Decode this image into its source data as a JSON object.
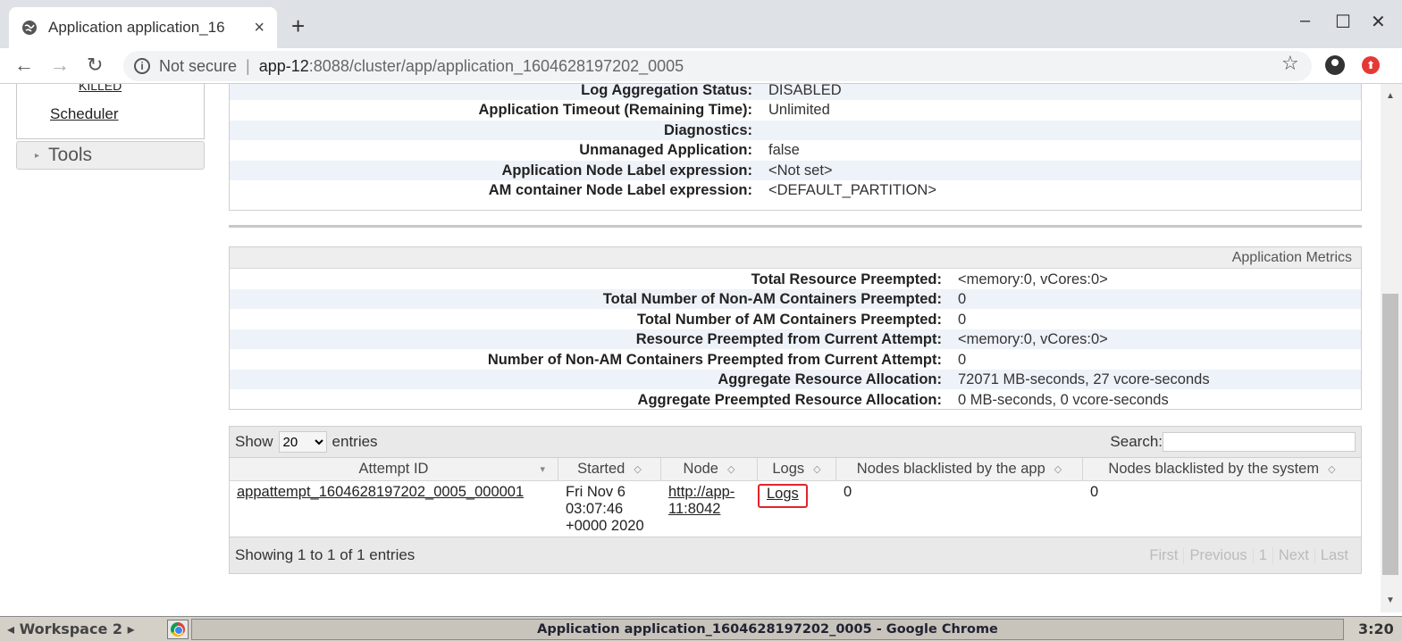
{
  "browser": {
    "tab_title": "Application application_16",
    "tab_close": "×",
    "new_tab": "+",
    "win_min": "–",
    "win_max": "☐",
    "win_close": "✕",
    "url_not_secure": "Not secure",
    "url_host": "app-12",
    "url_path": ":8088/cluster/app/application_1604628197202_0005"
  },
  "sidebar": {
    "killed_label": "KILLED",
    "scheduler_label": "Scheduler",
    "tools_label": "Tools"
  },
  "app_overview": {
    "rows": [
      {
        "key": "Log Aggregation Status:",
        "value": "DISABLED"
      },
      {
        "key": "Application Timeout (Remaining Time):",
        "value": "Unlimited"
      },
      {
        "key": "Diagnostics:",
        "value": ""
      },
      {
        "key": "Unmanaged Application:",
        "value": "false"
      },
      {
        "key": "Application Node Label expression:",
        "value": "<Not set>"
      },
      {
        "key": "AM container Node Label expression:",
        "value": "<DEFAULT_PARTITION>"
      }
    ]
  },
  "metrics": {
    "header": "Application Metrics",
    "rows": [
      {
        "key": "Total Resource Preempted:",
        "value": "<memory:0, vCores:0>"
      },
      {
        "key": "Total Number of Non-AM Containers Preempted:",
        "value": "0"
      },
      {
        "key": "Total Number of AM Containers Preempted:",
        "value": "0"
      },
      {
        "key": "Resource Preempted from Current Attempt:",
        "value": "<memory:0, vCores:0>"
      },
      {
        "key": "Number of Non-AM Containers Preempted from Current Attempt:",
        "value": "0"
      },
      {
        "key": "Aggregate Resource Allocation:",
        "value": "72071 MB-seconds, 27 vcore-seconds"
      },
      {
        "key": "Aggregate Preempted Resource Allocation:",
        "value": "0 MB-seconds, 0 vcore-seconds"
      }
    ]
  },
  "attempts_table": {
    "show_label": "Show",
    "page_size": "20",
    "entries_label": "entries",
    "search_label": "Search:",
    "columns": [
      "Attempt ID",
      "Started",
      "Node",
      "Logs",
      "Nodes blacklisted by the app",
      "Nodes blacklisted by the system"
    ],
    "rows": [
      {
        "attempt_id": "appattempt_1604628197202_0005_000001",
        "started_l1": "Fri Nov 6",
        "started_l2": "03:07:46",
        "started_l3": "+0000 2020",
        "node_l1": "http://app-",
        "node_l2": "11:8042",
        "logs": "Logs",
        "blacklisted_app": "0",
        "blacklisted_system": "0"
      }
    ],
    "footer_info": "Showing 1 to 1 of 1 entries",
    "pager": {
      "first": "First",
      "previous": "Previous",
      "page": "1",
      "next": "Next",
      "last": "Last"
    }
  },
  "taskbar": {
    "workspace": "◂ Workspace 2 ▸",
    "window_title": "Application application_1604628197202_0005 - Google Chrome",
    "clock": "3:20"
  }
}
